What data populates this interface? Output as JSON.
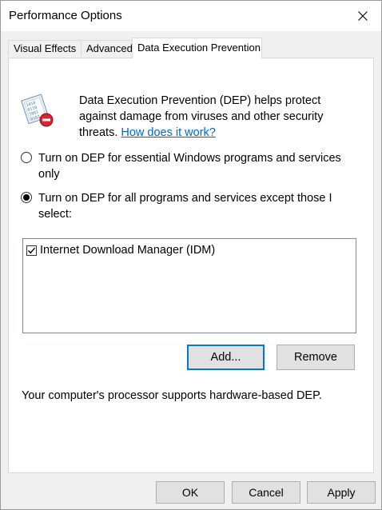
{
  "window": {
    "title": "Performance Options"
  },
  "tabs": [
    {
      "label": "Visual Effects"
    },
    {
      "label": "Advanced"
    },
    {
      "label": "Data Execution Prevention"
    }
  ],
  "active_tab": "Data Execution Prevention",
  "dep": {
    "intro_text": "Data Execution Prevention (DEP) helps protect against damage from viruses and other security threats.",
    "link_text": "How does it work?",
    "icon": "dep-shield-icon",
    "option_essential": "Turn on DEP for essential Windows programs and services only",
    "option_all": "Turn on DEP for all programs and services except those I select:",
    "selected_option": "option_all",
    "exceptions": [
      {
        "label": "Internet Download Manager (IDM)",
        "checked": true
      }
    ],
    "add_label": "Add...",
    "remove_label": "Remove",
    "support_text": "Your computer's processor supports hardware-based DEP."
  },
  "footer": {
    "ok_label": "OK",
    "cancel_label": "Cancel",
    "apply_label": "Apply"
  },
  "colors": {
    "link": "#0066cc",
    "default_button_border": "#0078d7"
  }
}
